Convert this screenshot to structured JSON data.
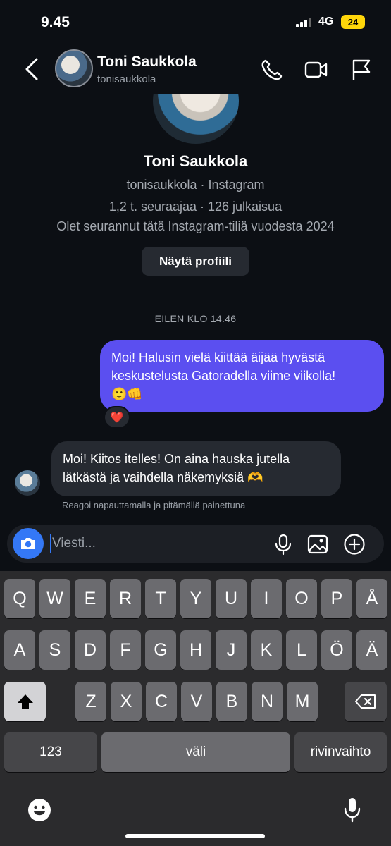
{
  "status": {
    "time": "9.45",
    "network": "4G",
    "battery": "24"
  },
  "header": {
    "name": "Toni Saukkola",
    "username": "tonisaukkola",
    "icons": [
      "chevron-left-icon",
      "phone-icon",
      "video-camera-icon",
      "flag-icon"
    ]
  },
  "profile": {
    "name": "Toni Saukkola",
    "source": "tonisaukkola · Instagram",
    "stats": "1,2 t. seuraajaa · 126 julkaisua",
    "following": "Olet seurannut tätä Instagram-tiliä vuodesta 2024",
    "button": "Näytä profiili"
  },
  "conversation": {
    "timestamp": "EILEN KLO 14.46",
    "outgoing": {
      "line1": "Moi! Halusin vielä kiittää äijää hyvästä",
      "line2": "keskustelusta Gatoradella viime viikolla!",
      "line3": "🙂👊",
      "reaction": "❤️"
    },
    "incoming": {
      "line1": "Moi! Kiitos itelles! On aina hauska jutella",
      "line2": "lätkästä ja vaihdella näkemyksiä 🫶"
    },
    "hint": "Reagoi napauttamalla ja pitämällä painettuna"
  },
  "composer": {
    "placeholder": "Viesti...",
    "icons": [
      "camera-icon",
      "microphone-icon",
      "image-icon",
      "plus-circle-icon"
    ]
  },
  "keyboard": {
    "row1": [
      "Q",
      "W",
      "E",
      "R",
      "T",
      "Y",
      "U",
      "I",
      "O",
      "P",
      "Å"
    ],
    "row2": [
      "A",
      "S",
      "D",
      "F",
      "G",
      "H",
      "J",
      "K",
      "L",
      "Ö",
      "Ä"
    ],
    "row3": [
      "Z",
      "X",
      "C",
      "V",
      "B",
      "N",
      "M"
    ],
    "numbers": "123",
    "space": "väli",
    "return": "rivinvaihto",
    "icons": [
      "shift-icon",
      "backspace-icon",
      "emoji-icon",
      "dictation-icon"
    ]
  },
  "colors": {
    "accent": "#5b4ff0",
    "camera": "#3478f6",
    "background": "#0c0f14"
  }
}
